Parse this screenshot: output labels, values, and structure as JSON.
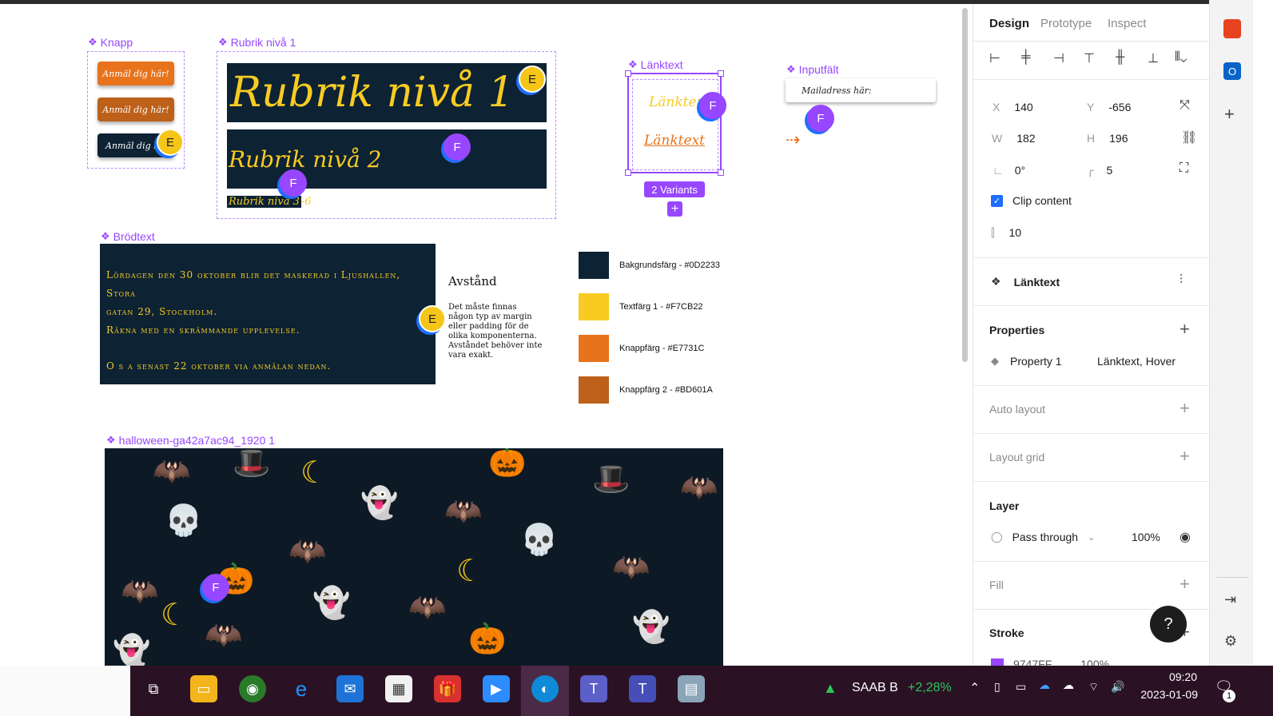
{
  "canvas": {
    "knapp": {
      "label": "Knapp",
      "buttons": [
        "Anmäl dig här!",
        "Anmäl dig här!",
        "Anmäl dig h"
      ],
      "colors": [
        "#E7731C",
        "#BD601A",
        "#0D2233"
      ]
    },
    "rubrik": {
      "label": "Rubrik nivå 1",
      "h1": "Rubrik nivå 1",
      "h2": "Rubrik nivå 2",
      "h3": "Rubrik nivå 3",
      "h3_suffix": "-6"
    },
    "lanktext": {
      "label": "Länktext",
      "text_default": "Länktext",
      "text_hover": "Länktext",
      "variants_badge": "2 Variants"
    },
    "inputfalt": {
      "label": "Inputfält",
      "placeholder": "Mailadress här:"
    },
    "brodtext": {
      "label": "Brödtext",
      "line1": "Lördagen den 30 oktober blir det maskerad i Ljushallen, Stora",
      "line2": "gatan 29, Stockholm.",
      "line3": "Räkna med en skrämmande upplevelse.",
      "line4": "O s a senast 22 oktober via anmälan nedan."
    },
    "avstand": {
      "title": "Avstånd",
      "body": "Det måste finnas någon typ av margin eller padding för de olika komponenterna. Avståndet behöver inte vara exakt."
    },
    "swatches": [
      {
        "label": "Bakgrundsfärg - #0D2233",
        "color": "#0D2233"
      },
      {
        "label": "Textfärg 1 - #F7CB22",
        "color": "#F7CB22"
      },
      {
        "label": "Knappfärg - #E7731C",
        "color": "#E7731C"
      },
      {
        "label": "Knappfärg 2 - #BD601A",
        "color": "#BD601A"
      }
    ],
    "image_frame": {
      "label": "halloween-ga42a7ac94_1920 1"
    },
    "avatars": {
      "f": "F",
      "e": "E"
    }
  },
  "panel": {
    "tabs": [
      "Design",
      "Prototype",
      "Inspect"
    ],
    "x_label": "X",
    "x_value": "140",
    "y_label": "Y",
    "y_value": "-656",
    "w_label": "W",
    "w_value": "182",
    "h_label": "H",
    "h_value": "196",
    "rotation": "0°",
    "radius": "5",
    "clip_content": "Clip content",
    "spacing": "10",
    "component_name": "Länktext",
    "properties_title": "Properties",
    "property_name": "Property 1",
    "property_value": "Länktext, Hover",
    "auto_layout": "Auto layout",
    "layout_grid": "Layout grid",
    "layer_title": "Layer",
    "blend_mode": "Pass through",
    "opacity": "100%",
    "fill": "Fill",
    "stroke": "Stroke",
    "stroke_hex": "9747FF",
    "stroke_opacity": "100%",
    "help": "?"
  },
  "taskbar": {
    "stock_name": "SAAB B",
    "stock_change": "+2,28%",
    "time": "09:20",
    "date": "2023-01-09",
    "notification_count": "1"
  }
}
